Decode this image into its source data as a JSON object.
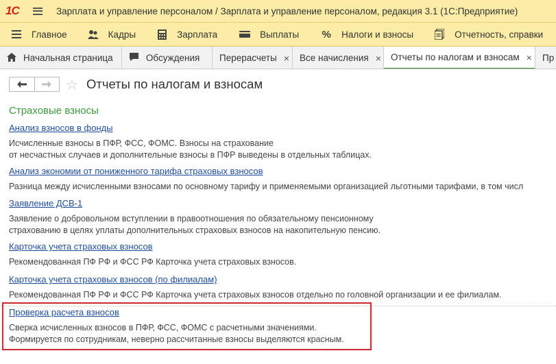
{
  "app": {
    "logo": "1С",
    "window_title": "Зарплата и управление персоналом / Зарплата и управление персоналом, редакция 3.1  (1С:Предприятие)"
  },
  "sections": [
    {
      "label": "Главное",
      "icon": "menu-icon"
    },
    {
      "label": "Кадры",
      "icon": "people-icon"
    },
    {
      "label": "Зарплата",
      "icon": "calculator-icon"
    },
    {
      "label": "Выплаты",
      "icon": "wallet-icon"
    },
    {
      "label": "Налоги и взносы",
      "icon": "percent-icon"
    },
    {
      "label": "Отчетность, справки",
      "icon": "reports-icon"
    }
  ],
  "tabs": [
    {
      "label": "Начальная страница",
      "icon": "home-icon"
    },
    {
      "label": "Обсуждения",
      "icon": "chat-icon"
    },
    {
      "label": "Перерасчеты",
      "close": "×"
    },
    {
      "label": "Все начисления",
      "close": "×"
    },
    {
      "label": "Отчеты по налогам и взносам",
      "close": "×",
      "active": true
    },
    {
      "label": "Пр"
    }
  ],
  "form": {
    "title": "Отчеты по налогам и взносам",
    "back": "🡐",
    "forward": "🡒",
    "favorite": "☆"
  },
  "section_title": "Страховые взносы",
  "reports": [
    {
      "link": "Анализ взносов в фонды",
      "description": "Исчисленные взносы в ПФР, ФСС, ФОМС. Взносы на страхование\nот несчастных случаев и дополнительные взносы в ПФР выведены в отдельных таблицах."
    },
    {
      "link": "Анализ экономии от пониженного тарифа страховых взносов",
      "description": "Разница между исчисленными взносами по основному тарифу и применяемыми организацией льготными тарифами, в том числ"
    },
    {
      "link": "Заявление ДСВ-1",
      "description": "Заявление о добровольном вступлении в правоотношения по обязательному пенсионному\nстрахованию в целях уплаты дополнительных страховых взносов на накопительную пенсию."
    },
    {
      "link": "Карточка учета страховых взносов",
      "description": "Рекомендованная ПФ РФ и ФСС РФ Карточка учета страховых взносов."
    },
    {
      "link": "Карточка учета страховых взносов (по филиалам)",
      "description": "Рекомендованная ПФ РФ и ФСС РФ Карточка учета страховых взносов отдельно по головной организации и ее филиалам."
    },
    {
      "link": "Проверка расчета взносов",
      "description": "Сверка исчисленных взносов в ПФР, ФСС, ФОМС с расчетными значениями.\nФормируется по сотрудникам, неверно рассчитанные взносы выделяются красным."
    }
  ],
  "colors": {
    "accent_bar": "#fbeda6",
    "link": "#1f4f9a",
    "section_title": "#3c9a3c",
    "highlight": "#d3262f"
  }
}
